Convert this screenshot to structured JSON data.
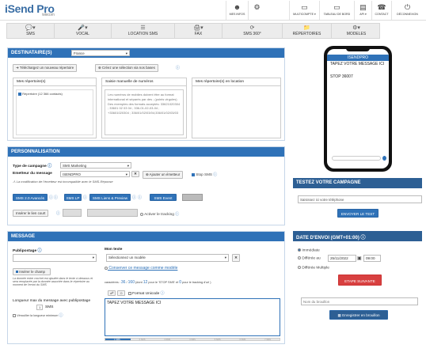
{
  "brand": {
    "logo_main": "iSend Pro",
    "logo_sub": "telecom"
  },
  "topnav": [
    {
      "label": "MES INFOS",
      "icon": "user-icon"
    },
    {
      "label": "",
      "icon": "gears-icon"
    },
    {
      "label": "MULTICOMPTE ▾",
      "icon": "tablet-icon"
    },
    {
      "label": "TABLEAU DE BORD",
      "icon": "tablet-icon"
    },
    {
      "label": "API ▾",
      "icon": "document-icon"
    },
    {
      "label": "CONTACT",
      "icon": "phone-icon"
    },
    {
      "label": "DÉCONNEXION",
      "icon": "power-icon"
    }
  ],
  "mainnav": [
    {
      "label": "SMS",
      "icon": "chat-icon"
    },
    {
      "label": "VOCAL",
      "icon": "microphone-icon"
    },
    {
      "label": "LOCATION SMS",
      "icon": "list-icon"
    },
    {
      "label": "FAX",
      "icon": "fax-icon"
    },
    {
      "label": "SMS 360°",
      "icon": "rotate-icon"
    },
    {
      "label": "RÉPERTOIRES",
      "icon": "folder-icon"
    },
    {
      "label": "MODELES",
      "icon": "gear-icon"
    }
  ],
  "dest": {
    "title": "DESTINATAIRE(S)",
    "country": "France",
    "upload_btn": "Téléchargez un nouveau répertoire",
    "create_btn": "Créez une sélection via nos bases",
    "col1": "Mes répertoire(s)",
    "col2": "Saisie manuelle de numéros",
    "col3": "Mes répertoire(s) en location",
    "repo_item": "Répertoire (12 366 contacts)",
    "manual_help": "Les numéros de mobiles doivent être au format international et séparés par des ; (points virgules) Des exemples des formats acceptés: 33621020304 ; 33601 02 03 04 ; 336-01-02-03-04 ; +33601020304 ; 336/01/02/03/04;336/01/02/03/03"
  },
  "perso": {
    "title": "PERSONNALISATION",
    "type_label": "Type de campagne",
    "type_value": "SMS Marketing",
    "sender_label": "Emetteur du message",
    "sender_value": "ISENDPRO",
    "add_sender_btn": "Ajouter un émetteur",
    "stop_label": "Stop SMS",
    "sender_note": "La modification de l'émetteur est incompatible avec le SMS-Réponse",
    "tabs": [
      "SMS 2.0 Avancés",
      "SMS LP",
      "SMS Liens & Preview",
      "SMS Event"
    ],
    "shortlink_btn": "Insérer le lien court",
    "tracking_label": "Activer le tracking"
  },
  "message": {
    "title": "MESSAGE",
    "publipostage_label": "Publipostage",
    "insert_btn": "Insérer le champ",
    "publi_note": "La donnée entre crochet est ajoutée dans le texte ci-dessous et sera remplacée par la donnée associée dans le répertoire au moment de l'envoi du SMS",
    "maxlen_label": "Longueur max du message avec publipostage",
    "maxlen_value": "1",
    "maxlen_unit": "SMS",
    "verify_label": "Vérouiller la longueur minimum",
    "montexte_label": "Mon texte",
    "model_select": "Sélectionnez un modèle",
    "save_model_link": "Conserver ce message comme modèle",
    "counter_prefix": "caractères :",
    "counter_used": "36",
    "counter_max": "160",
    "counter_mid": "(dont",
    "counter_stop": "12",
    "counter_mid2": "pour le 'STOP SMS' et",
    "counter_track": "0",
    "counter_end": "pour le tracking d'url )",
    "unicode_label": "Format Unicode",
    "text": "TAPEZ VOTRE MESSAGE ICI",
    "progress": [
      "1 SMS",
      "2 SMS",
      "3 SMS",
      "4 SMS",
      "5 SMS",
      "6 SMS",
      "7 SMS"
    ]
  },
  "phone": {
    "sender": "ISENDPRO",
    "msg": "TAPEZ VOTRE MESSAGE ICI",
    "stop": "STOP 36007"
  },
  "test": {
    "title": "TESTEZ VOTRE CAMPAGNE",
    "placeholder": "Saisissez ici votre téléphone",
    "button": "ENVOYER LE TEST"
  },
  "date": {
    "title": "DATE D'ENVOI (GMT+01:00)",
    "opt1": "Immédiate",
    "opt2": "Différée au",
    "date_value": "25/11/2022",
    "time_value": "09:00",
    "opt3": "Différée Multiple",
    "next_btn": "ETAPE SUIVANTE",
    "draft_placeholder": "Nom du brouillon",
    "save_btn": "Enregistrer en brouillon"
  }
}
